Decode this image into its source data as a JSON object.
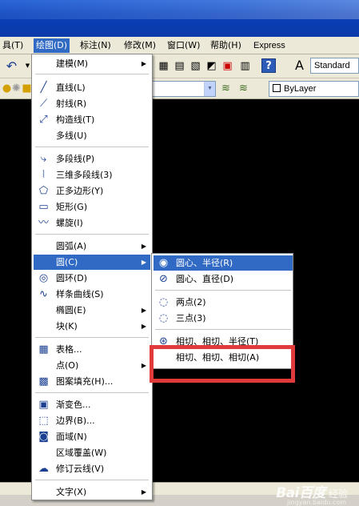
{
  "menubar": {
    "items": [
      {
        "label": "工具(T)",
        "active": false
      },
      {
        "label": "绘图(D)",
        "active": true
      },
      {
        "label": "标注(N)",
        "active": false
      },
      {
        "label": "修改(M)",
        "active": false
      },
      {
        "label": "窗口(W)",
        "active": false
      },
      {
        "label": "帮助(H)",
        "active": false
      },
      {
        "label": "Express",
        "active": false
      }
    ],
    "first_visible": "具(T)"
  },
  "toolbar": {
    "text_style": "Standard",
    "layer": "ByLayer"
  },
  "draw_menu": {
    "items": [
      {
        "label": "建模(M)",
        "icon": "none",
        "submenu": true
      },
      {
        "label": "直线(L)",
        "icon": "line-icon"
      },
      {
        "label": "射线(R)",
        "icon": "ray-icon"
      },
      {
        "label": "构造线(T)",
        "icon": "construction-line-icon"
      },
      {
        "label": "多线(U)",
        "icon": "none"
      },
      {
        "label": "多段线(P)",
        "icon": "polyline-icon"
      },
      {
        "label": "三维多段线(3)",
        "icon": "3d-polyline-icon"
      },
      {
        "label": "正多边形(Y)",
        "icon": "polygon-icon"
      },
      {
        "label": "矩形(G)",
        "icon": "rectangle-icon"
      },
      {
        "label": "螺旋(I)",
        "icon": "helix-icon"
      },
      {
        "label": "圆弧(A)",
        "icon": "none",
        "submenu": true
      },
      {
        "label": "圆(C)",
        "icon": "none",
        "submenu": true,
        "highlighted": true
      },
      {
        "label": "圆环(D)",
        "icon": "donut-icon"
      },
      {
        "label": "样条曲线(S)",
        "icon": "spline-icon"
      },
      {
        "label": "椭圆(E)",
        "icon": "none",
        "submenu": true
      },
      {
        "label": "块(K)",
        "icon": "none",
        "submenu": true
      },
      {
        "label": "表格...",
        "icon": "table-icon"
      },
      {
        "label": "点(O)",
        "icon": "none",
        "submenu": true
      },
      {
        "label": "图案填充(H)...",
        "icon": "hatch-icon"
      },
      {
        "label": "渐变色...",
        "icon": "gradient-icon"
      },
      {
        "label": "边界(B)...",
        "icon": "boundary-icon"
      },
      {
        "label": "面域(N)",
        "icon": "region-icon"
      },
      {
        "label": "区域覆盖(W)",
        "icon": "none"
      },
      {
        "label": "修订云线(V)",
        "icon": "revcloud-icon"
      },
      {
        "label": "文字(X)",
        "icon": "none",
        "submenu": true
      }
    ]
  },
  "circle_submenu": {
    "items": [
      {
        "label": "圆心、半径(R)",
        "icon": "center-radius-icon",
        "highlighted": true
      },
      {
        "label": "圆心、直径(D)",
        "icon": "center-diameter-icon"
      },
      {
        "label": "两点(2)",
        "icon": "two-point-icon"
      },
      {
        "label": "三点(3)",
        "icon": "three-point-icon"
      },
      {
        "label": "相切、相切、半径(T)",
        "icon": "ttr-icon"
      },
      {
        "label": "相切、相切、相切(A)",
        "icon": "none"
      }
    ]
  },
  "watermark": {
    "logo": "Bai百度",
    "sub": "经验",
    "url": "jingyan.baidu.com"
  },
  "colors": {
    "highlight": "#316ac5",
    "annotation": "#e03a3a"
  }
}
